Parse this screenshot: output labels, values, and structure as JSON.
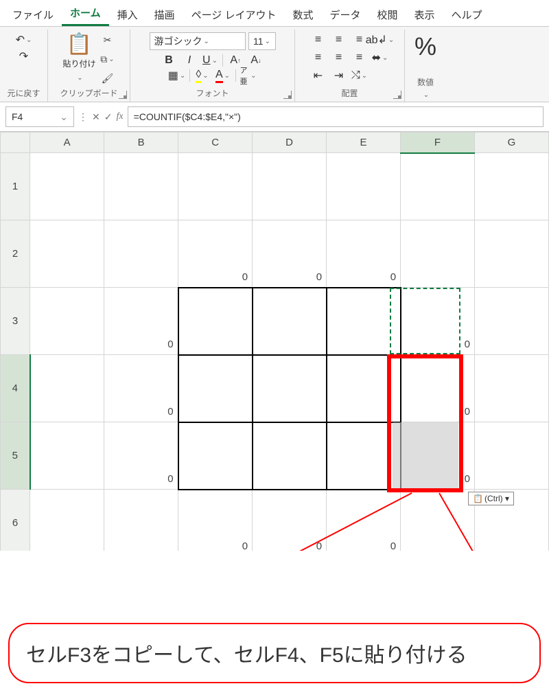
{
  "menu": {
    "file": "ファイル",
    "home": "ホーム",
    "insert": "挿入",
    "draw": "描画",
    "layout": "ページ レイアウト",
    "formula": "数式",
    "data": "データ",
    "review": "校閲",
    "view": "表示",
    "help": "ヘルプ"
  },
  "ribbon": {
    "undo_group": "元に戻す",
    "clipboard_group": "クリップボード",
    "paste_label": "貼り付け",
    "font_group": "フォント",
    "font_name": "游ゴシック",
    "font_size": "11",
    "align_group": "配置",
    "number_group": "数値"
  },
  "namebox": "F4",
  "formula": "=COUNTIF($C4:$E4,\"×\")",
  "cols": [
    "A",
    "B",
    "C",
    "D",
    "E",
    "F",
    "G"
  ],
  "rows": [
    "1",
    "2",
    "3",
    "4",
    "5",
    "6"
  ],
  "cells": {
    "C2": "0",
    "D2": "0",
    "E2": "0",
    "B3": "0",
    "F3": "0",
    "B4": "0",
    "F4": "0",
    "B5": "0",
    "F5": "0",
    "C6": "0",
    "D6": "0",
    "E6": "0"
  },
  "ctrl_hint": "(Ctrl) ▾",
  "callout": "セルF3をコピーして、セルF4、F5に貼り付ける"
}
